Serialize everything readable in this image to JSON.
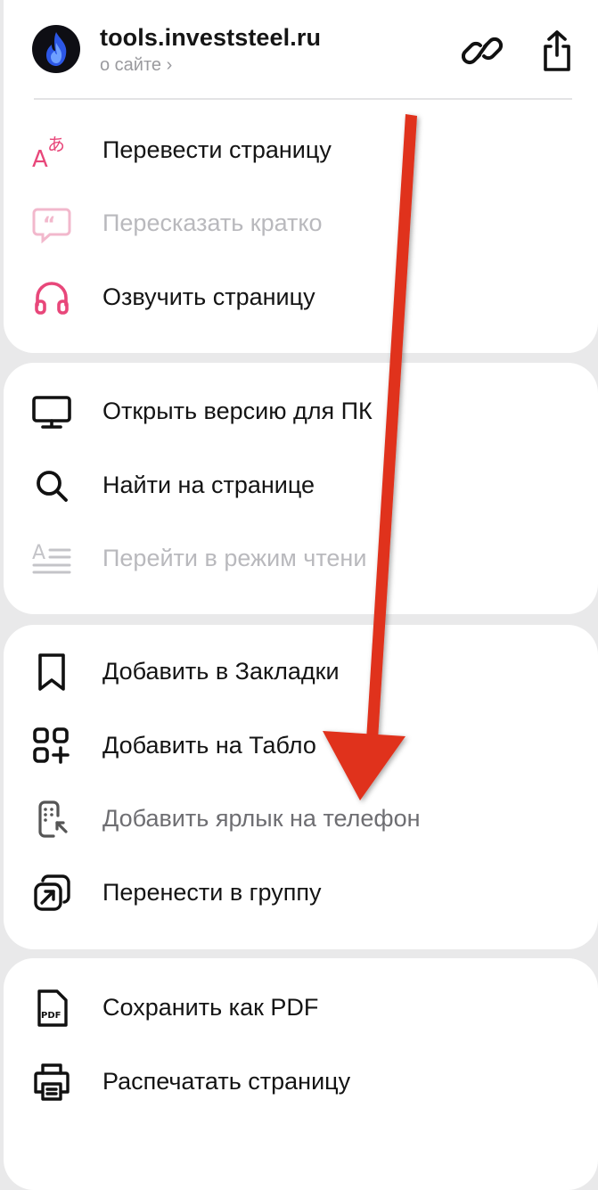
{
  "header": {
    "domain": "tools.investsteel.ru",
    "about": "о сайте ›"
  },
  "group1": [
    {
      "label": "Перевести страницу",
      "icon": "translate-icon",
      "enabled": true
    },
    {
      "label": "Пересказать кратко",
      "icon": "quote-summary-icon",
      "enabled": false
    },
    {
      "label": "Озвучить страницу",
      "icon": "headphones-icon",
      "enabled": true
    }
  ],
  "group2": [
    {
      "label": "Открыть версию для ПК",
      "icon": "desktop-icon",
      "enabled": true
    },
    {
      "label": "Найти на странице",
      "icon": "search-icon",
      "enabled": true
    },
    {
      "label": "Перейти в режим чтени",
      "icon": "reader-mode-icon",
      "enabled": false
    }
  ],
  "group3": [
    {
      "label": "Добавить в Закладки",
      "icon": "bookmark-icon",
      "enabled": true
    },
    {
      "label": "Добавить на Табло",
      "icon": "add-to-grid-icon",
      "enabled": true
    },
    {
      "label": "Добавить ярлык на телефон",
      "icon": "phone-shortcut-icon",
      "enabled": true
    },
    {
      "label": "Перенести в группу",
      "icon": "move-to-group-icon",
      "enabled": true
    }
  ],
  "group4": [
    {
      "label": "Сохранить как PDF",
      "icon": "pdf-file-icon",
      "enabled": true
    },
    {
      "label": "Распечатать страницу",
      "icon": "printer-icon",
      "enabled": true
    }
  ],
  "colors": {
    "accent_pink": "#e8477a",
    "arrow_red": "#e0301e",
    "text_primary": "#141414",
    "text_disabled": "#b9b9bd"
  }
}
